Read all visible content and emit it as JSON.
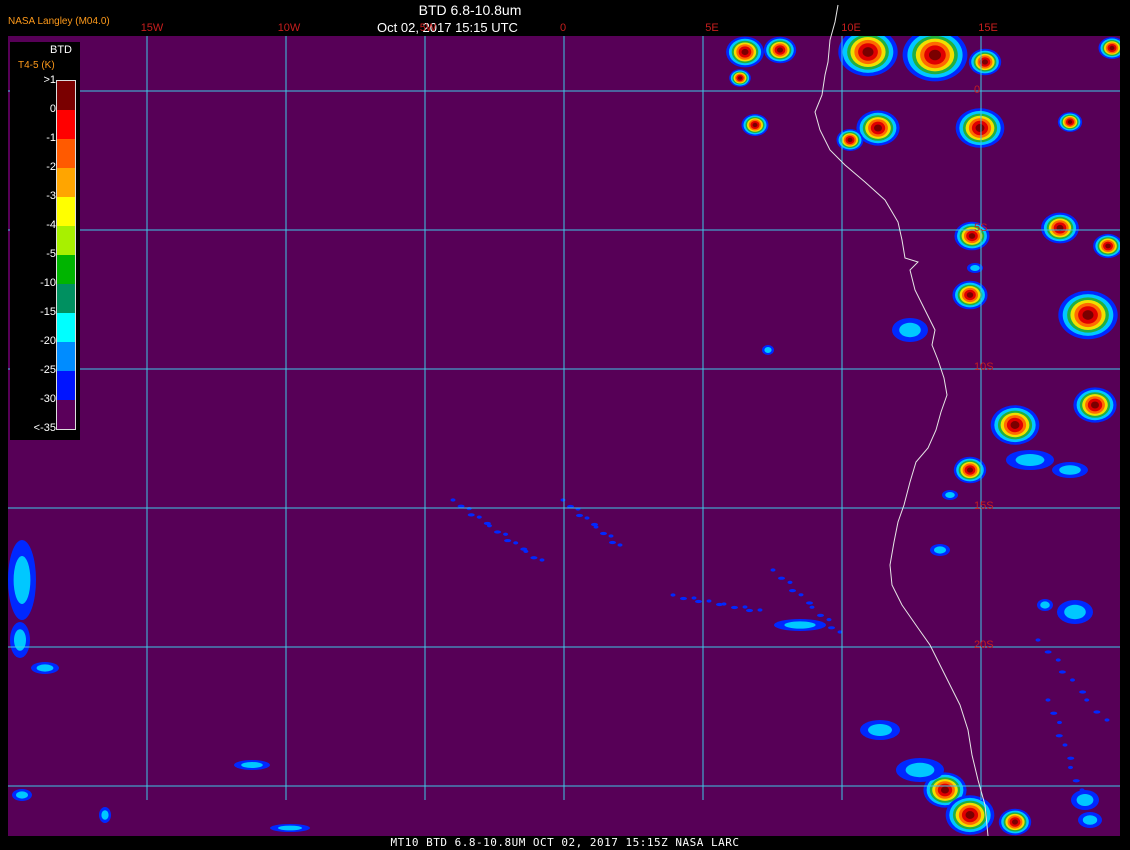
{
  "header": {
    "credit": "NASA Langley (M04.0)",
    "product_title": "BTD 6.8-10.8um",
    "timestamp": "Oct 02, 2017 15:15 UTC"
  },
  "footer": {
    "caption": "MT10  BTD 6.8-10.8UM  OCT 02, 2017 15:15Z  NASA LARC"
  },
  "grid": {
    "longitude_labels": [
      "15W",
      "10W",
      "5W",
      "0",
      "5E",
      "10E",
      "15E"
    ],
    "latitude_labels": [
      "0",
      "5S",
      "10S",
      "15S",
      "20S"
    ]
  },
  "legend": {
    "title": "BTD",
    "units": "T4-5 (K)",
    "ticks": [
      ">1",
      "0",
      "-1",
      "-2",
      "-3",
      "-4",
      "-5",
      "-10",
      "-15",
      "-20",
      "-25",
      "-30",
      "<-35"
    ],
    "colors": [
      "#7a0000",
      "#ff0000",
      "#ff5a00",
      "#ffa500",
      "#ffff00",
      "#a8f000",
      "#00b400",
      "#009060",
      "#00ffff",
      "#008cff",
      "#0014ff",
      "#5a005a"
    ]
  },
  "colors": {
    "background": "#570057",
    "grid_lines": "#3ec8e6",
    "coastline": "#e6e6e6",
    "grid_labels": "#c81e1e"
  }
}
